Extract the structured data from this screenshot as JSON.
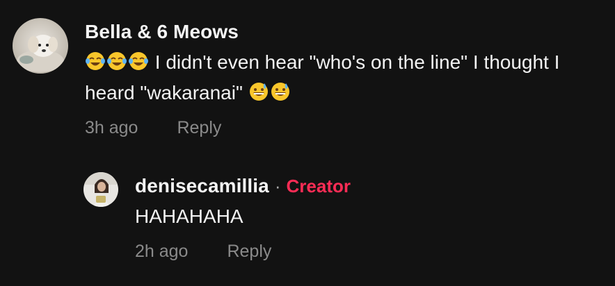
{
  "comments": [
    {
      "username": "Bella & 6 Meows",
      "text_before": "I didn't even hear \"who's on the line\" I thought I heard \"wakaranai\"",
      "leading_emoji": "face-with-tears-of-joy-icon",
      "leading_emoji_count": 3,
      "trailing_emoji": "grinning-face-with-sweat-icon",
      "trailing_emoji_count": 2,
      "time": "3h ago",
      "reply_label": "Reply"
    }
  ],
  "reply": {
    "username": "denisecamillia",
    "separator": "·",
    "badge": "Creator",
    "text": "HAHAHAHA",
    "time": "2h ago",
    "reply_label": "Reply"
  },
  "colors": {
    "background": "#121212",
    "creator_badge": "#fe2c55",
    "meta_text": "#8a8a8a"
  }
}
